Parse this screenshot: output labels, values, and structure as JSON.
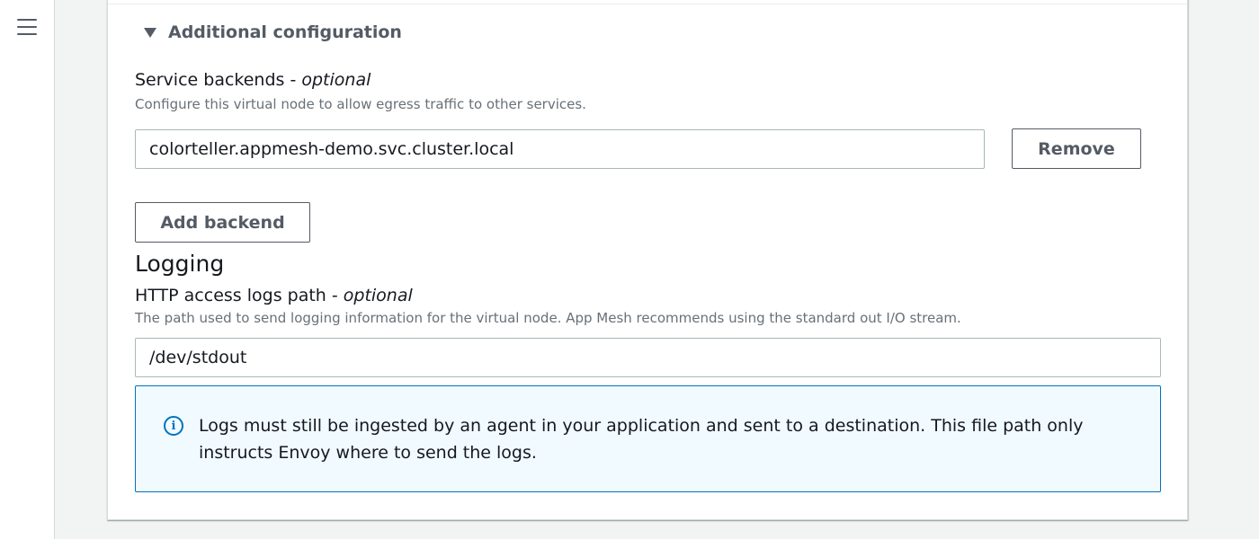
{
  "nav": {
    "menu_icon": "hamburger-menu-icon"
  },
  "additional_config": {
    "toggle_label": "Additional configuration",
    "expanded": true,
    "caret_icon": "caret-down-icon"
  },
  "service_backends": {
    "label": "Service backends - ",
    "label_optional": "optional",
    "description": "Configure this virtual node to allow egress traffic to other services.",
    "backends": [
      {
        "value": "colorteller.appmesh-demo.svc.cluster.local",
        "remove_label": "Remove"
      }
    ],
    "add_label": "Add backend"
  },
  "logging": {
    "title": "Logging",
    "label": "HTTP access logs path - ",
    "label_optional": "optional",
    "description": "The path used to send logging information for the virtual node. App Mesh recommends using the standard out I/O stream.",
    "value": "/dev/stdout",
    "info_icon": "info-icon",
    "info_text": "Logs must still be ingested by an agent in your application and sent to a destination. This file path only instructs Envoy where to send the logs."
  },
  "colors": {
    "accent": "#0073bb",
    "info_background": "#f1faff",
    "button_text": "#545b64"
  }
}
